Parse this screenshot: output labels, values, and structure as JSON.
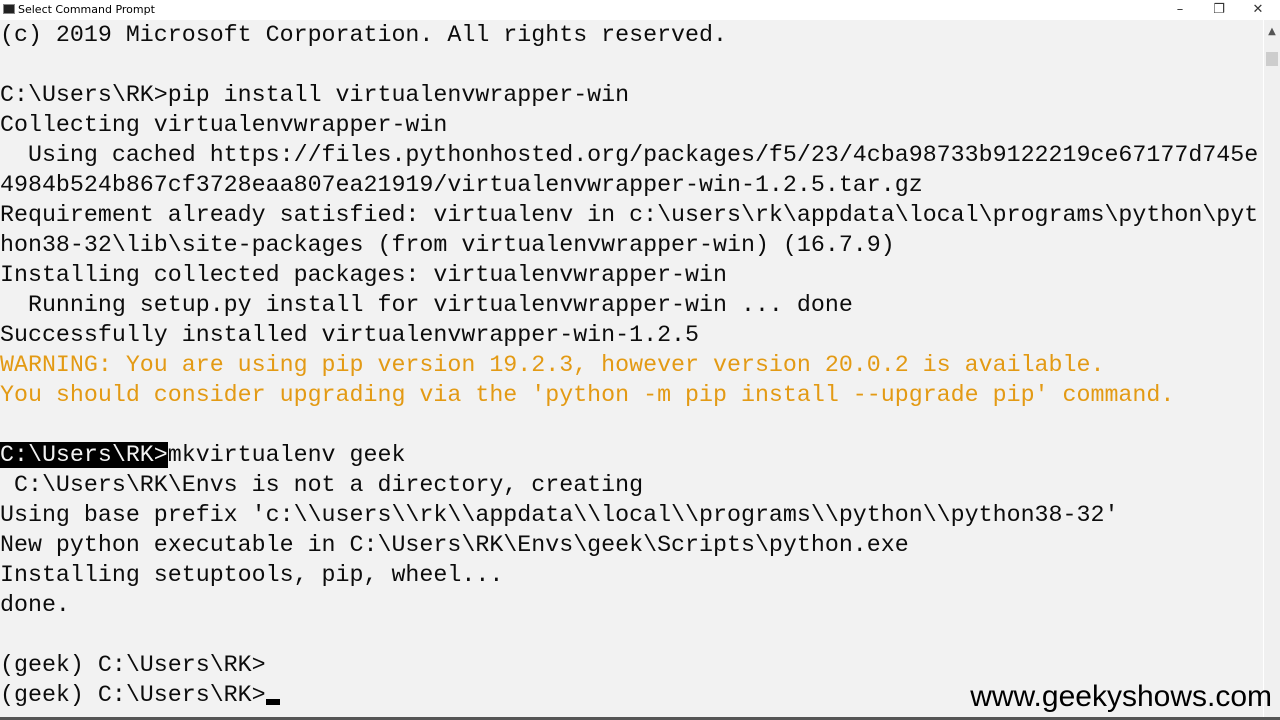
{
  "window": {
    "title": "Select Command Prompt",
    "icon": "cmd-icon"
  },
  "colors": {
    "background": "#f2f2f2",
    "text": "#0c0c0c",
    "warning": "#e39a14"
  },
  "console": {
    "lines": [
      "(c) 2019 Microsoft Corporation. All rights reserved.",
      "",
      "C:\\Users\\RK>pip install virtualenvwrapper-win",
      "Collecting virtualenvwrapper-win",
      "  Using cached https://files.pythonhosted.org/packages/f5/23/4cba98733b9122219ce67177d745e",
      "4984b524b867cf3728eaa807ea21919/virtualenvwrapper-win-1.2.5.tar.gz",
      "Requirement already satisfied: virtualenv in c:\\users\\rk\\appdata\\local\\programs\\python\\pyt",
      "hon38-32\\lib\\site-packages (from virtualenvwrapper-win) (16.7.9)",
      "Installing collected packages: virtualenvwrapper-win",
      "  Running setup.py install for virtualenvwrapper-win ... done",
      "Successfully installed virtualenvwrapper-win-1.2.5"
    ],
    "warnings": [
      "WARNING: You are using pip version 19.2.3, however version 20.0.2 is available.",
      "You should consider upgrading via the 'python -m pip install --upgrade pip' command."
    ],
    "selected_prompt": "C:\\Users\\RK>",
    "command": "mkvirtualenv geek",
    "lines2": [
      " C:\\Users\\RK\\Envs is not a directory, creating",
      "Using base prefix 'c:\\\\users\\\\rk\\\\appdata\\\\local\\\\programs\\\\python\\\\python38-32'",
      "New python executable in C:\\Users\\RK\\Envs\\geek\\Scripts\\python.exe",
      "Installing setuptools, pip, wheel...",
      "done.",
      "",
      "(geek) C:\\Users\\RK>"
    ],
    "current_prompt": "(geek) C:\\Users\\RK>"
  },
  "watermark": "www.geekyshows.com"
}
